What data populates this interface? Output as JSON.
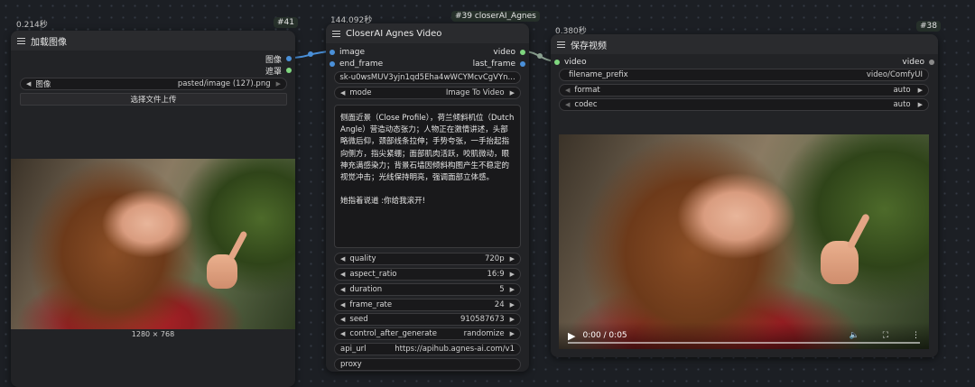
{
  "colors": {
    "canvas": "#1c1f24",
    "node": "#222326",
    "accent_link": "#4a90d9",
    "slot_green": "#7fd67f",
    "slot_blue": "#4a90d9"
  },
  "node41": {
    "timer": "0.214秒",
    "badge": "#41",
    "title": "加载图像",
    "outputs": [
      "图像",
      "遮罩"
    ],
    "image_widget": {
      "label": "图像",
      "value": "pasted/image (127).png"
    },
    "upload_button": "选择文件上传",
    "image_size": "1280 × 768",
    "image_icon": "photo-portrait-pointing"
  },
  "node39": {
    "timer": "144.092秒",
    "badge": "#39 closerAI_Agnes",
    "title": "CloserAI Agnes Video",
    "inputs": [
      "image",
      "end_frame"
    ],
    "outputs": [
      "video",
      "last_frame"
    ],
    "api_key": "sk-u0wsMUV3yjn1qd5Eha4wWCYMcvCgVYn...",
    "mode": {
      "label": "mode",
      "value": "Image To Video"
    },
    "prompt": "侧面近景（Close Profile），荷兰倾斜机位（Dutch Angle）营造动态张力；人物正在激情讲述，头部略微后仰，颈部线条拉伸；手势夸张，一手抬起指向侧方，指尖紧绷；面部肌肉活跃，咬肌微动，眼神充满感染力；背景石墙因倾斜构图产生不稳定的视觉冲击；光线保持明亮，强调面部立体感。\n\n她指着说道 :你给我滚开!",
    "params": [
      {
        "label": "quality",
        "value": "720p"
      },
      {
        "label": "aspect_ratio",
        "value": "16:9"
      },
      {
        "label": "duration",
        "value": "5"
      },
      {
        "label": "frame_rate",
        "value": "24"
      },
      {
        "label": "seed",
        "value": "910587673"
      },
      {
        "label": "control_after_generate",
        "value": "randomize"
      }
    ],
    "api_url": {
      "label": "api_url",
      "value": "https://apihub.agnes-ai.com/v1"
    },
    "proxy": {
      "label": "proxy",
      "value": ""
    }
  },
  "node38": {
    "timer": "0.380秒",
    "badge": "#38",
    "title": "保存视频",
    "input": "video",
    "output": "video",
    "filename_prefix": {
      "label": "filename_prefix",
      "value": "video/ComfyUI"
    },
    "format": {
      "label": "format",
      "value": "auto"
    },
    "codec": {
      "label": "codec",
      "value": "auto"
    },
    "player": {
      "time": "0:00 / 0:05",
      "progress": 0
    }
  }
}
